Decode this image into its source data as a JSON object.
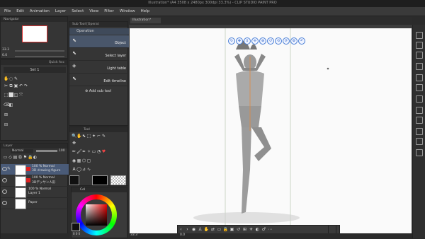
{
  "window": {
    "title": "Illustration* (A4 3508 x 2480px 300dpi 33.3%) - CLIP STUDIO PAINT PRO"
  },
  "menu": [
    "File",
    "Edit",
    "Animation",
    "Layer",
    "Select",
    "View",
    "Filter",
    "Window",
    "Help"
  ],
  "navigator": {
    "title": "Navigator",
    "zoom": "33.3",
    "rotate": "0.0"
  },
  "quick_access": {
    "tab": "Quick Acc",
    "set": "Set 1"
  },
  "sub_tool": {
    "tab": "Sub Tool [Operat",
    "group": "Operation",
    "items": [
      "Object",
      "Select layer",
      "Light table",
      "Edit timeline"
    ],
    "add_label": "Add sub tool"
  },
  "tool_panel": {
    "title": "Tool"
  },
  "layer_panel": {
    "title": "Layer",
    "blend": "Normal",
    "opacity": "100",
    "layers": [
      {
        "pct": "100 % Normal",
        "name": "3D drawing figure"
      },
      {
        "pct": "100 % Normal",
        "name": "3Dデッサン人形"
      },
      {
        "pct": "100 % Normal",
        "name": "Layer 1"
      },
      {
        "pct": "",
        "name": "Paper"
      }
    ]
  },
  "color_panel": {
    "tab": "Col",
    "h": "0",
    "s": "0",
    "v": "0"
  },
  "canvas": {
    "tab": "Illustration*",
    "status_zoom": "33.3",
    "status_rot": "0.0"
  }
}
